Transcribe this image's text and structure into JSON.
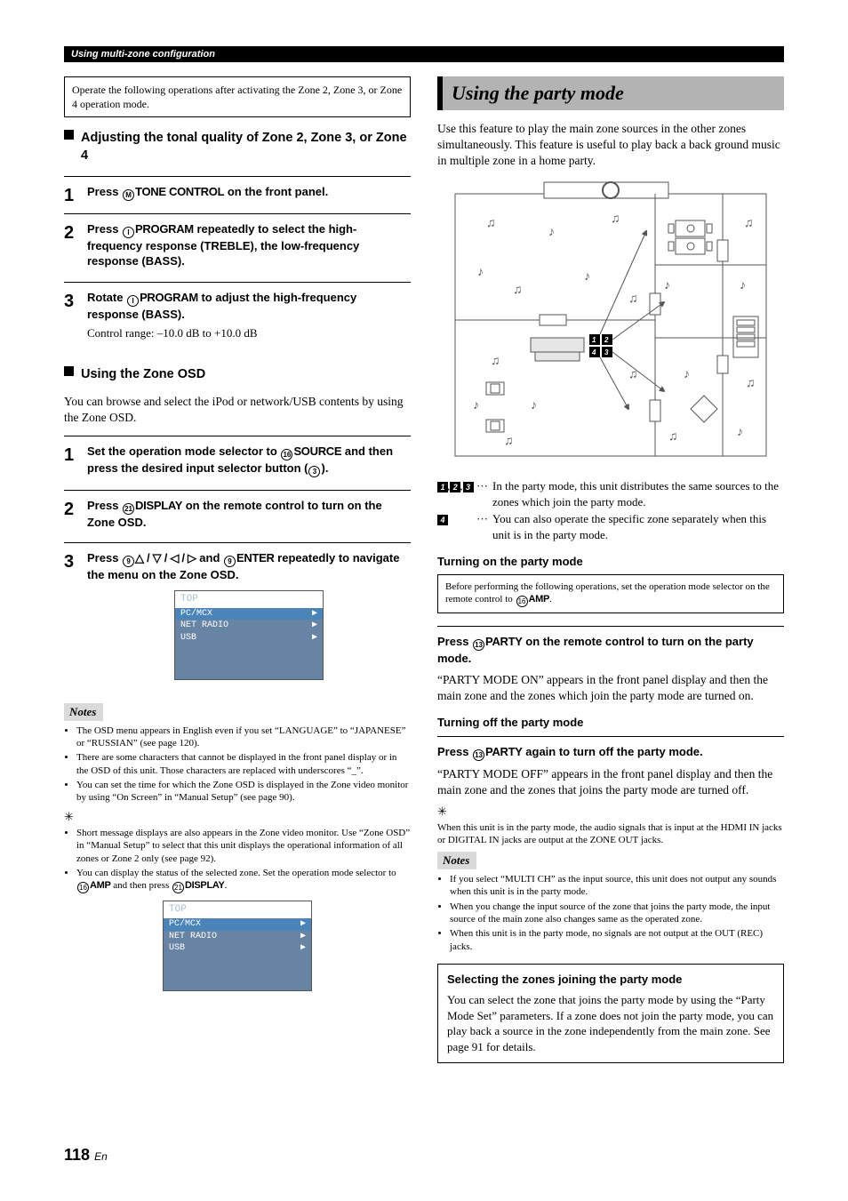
{
  "header": {
    "breadcrumb": "Using multi-zone configuration"
  },
  "left": {
    "opnote": "Operate the following operations after activating the Zone 2, Zone 3, or Zone 4 operation mode.",
    "h1": "Adjusting the tonal quality of Zone 2, Zone 3, or Zone 4",
    "s1": {
      "pre": "Press ",
      "circ": "M",
      "kw": "TONE CONTROL",
      "post": " on the front panel."
    },
    "s2": {
      "pre": "Press ",
      "circ": "I",
      "kw": "PROGRAM",
      "post": " repeatedly to select the high-frequency response (TREBLE), the low-frequency response (BASS)."
    },
    "s3": {
      "pre": "Rotate ",
      "circ": "I",
      "kw": "PROGRAM",
      "post": " to adjust the high-frequency response (BASS).",
      "extra": "Control range: –10.0 dB to +10.0 dB"
    },
    "h2": "Using the Zone OSD",
    "p_zone": "You can browse and select the iPod or network/USB contents by using the Zone OSD.",
    "u1": {
      "a": "Set the operation mode selector to ",
      "c1": "16",
      "k1": "SOURCE",
      "b": " and then press the desired input selector button (",
      "c2": "3",
      "c": ")."
    },
    "u2": {
      "a": "Press ",
      "c1": "21",
      "k1": "DISPLAY",
      "b": " on the remote control to turn on the Zone OSD."
    },
    "u3": {
      "a": "Press ",
      "c1": "9",
      "arr": "△ / ▽ / ◁ / ▷",
      "b": " and ",
      "c2": "9",
      "k2": "ENTER",
      "c": " repeatedly to navigate the menu on the Zone OSD."
    },
    "osd": {
      "title": "TOP",
      "r1": "PC/MCX",
      "r2": "NET RADIO",
      "r3": "USB"
    },
    "notes_label": "Notes",
    "notes": [
      "The OSD menu appears in English even if you set “LANGUAGE” to “JAPANESE” or “RUSSIAN” (see page 120).",
      "There are some characters that cannot be displayed in the front panel display or in the OSD of this unit. Those characters are replaced with underscores “_”.",
      "You can set the time for which the Zone OSD is displayed in the Zone video monitor by using “On Screen” in “Manual Setup” (see page 90)."
    ],
    "tips": [
      "Short message displays are also appears in the Zone video monitor. Use “Zone OSD” in “Manual Setup” to select that this unit displays the operational information of all zones or Zone 2 only (see page 92)."
    ],
    "tip2": {
      "a": "You can display the status of the selected zone. Set the operation mode selector to ",
      "c1": "16",
      "k1": "AMP",
      "b": " and then press ",
      "c2": "21",
      "k2": "DISPLAY",
      "c": "."
    }
  },
  "right": {
    "title": "Using the party mode",
    "intro": "Use this feature to play the main zone sources in the other zones simultaneously. This feature is useful to play back a back ground music in multiple zone in a home party.",
    "legend1": "In the party mode, this unit distributes the same sources to the zones which join the party mode.",
    "legend2": "You can also operate the specific zone separately when this unit is in the party mode.",
    "turn_on_h": "Turning on the party mode",
    "before": {
      "a": "Before performing the following operations, set the operation mode selector on the remote control to ",
      "c1": "16",
      "k1": "AMP",
      "b": "."
    },
    "press_on": {
      "a": "Press ",
      "c1": "13",
      "k1": "PARTY",
      "b": " on the remote control to turn on the party mode."
    },
    "on_body": "“PARTY MODE ON” appears in the front panel display and then the main zone and the zones which join the party mode are turned on.",
    "turn_off_h": "Turning off the party mode",
    "press_off": {
      "a": "Press ",
      "c1": "13",
      "k1": "PARTY",
      "b": " again to turn off the party mode."
    },
    "off_body": "“PARTY MODE OFF” appears in the front panel display and then the main zone and the zones that joins the party mode are turned off.",
    "tip": "When this unit is in the party mode, the audio signals that is input at the HDMI IN jacks or DIGITAL IN jacks are output at the ZONE OUT jacks.",
    "notes_label": "Notes",
    "notes": [
      "If you select “MULTI CH” as the input source, this unit does not output any sounds when this unit is in the party mode.",
      "When you change the input source of the zone that joins the party mode, the input source of the main zone also changes same as the operated zone.",
      "When this unit is in the party mode, no signals are not output at the OUT (REC) jacks."
    ],
    "box_h": "Selecting the zones joining the party mode",
    "box_b": "You can select the zone that joins the party mode by using the “Party Mode Set” parameters. If a zone does not join the party mode, you can play back a source in the zone independently from the main zone. See page 91 for details."
  },
  "page": {
    "num": "118",
    "suffix": "En"
  }
}
